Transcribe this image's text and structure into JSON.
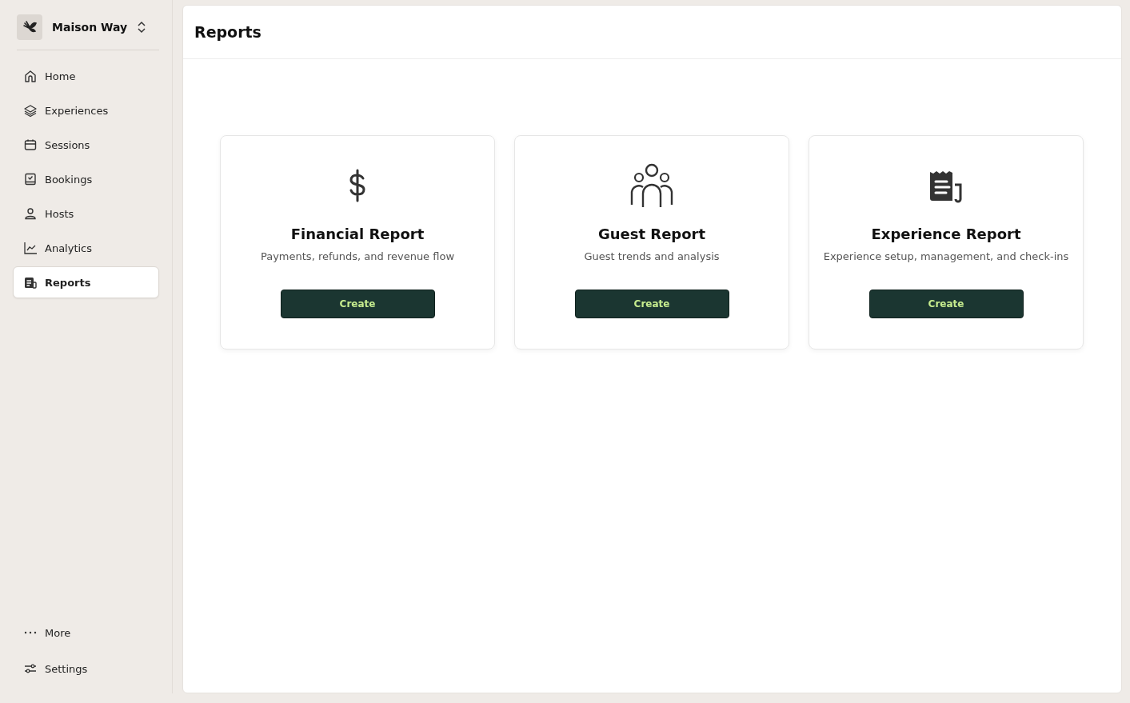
{
  "workspace": {
    "name": "Maison Way"
  },
  "nav": [
    {
      "label": "Home",
      "kind": "home",
      "selected": false
    },
    {
      "label": "Experiences",
      "kind": "layers",
      "selected": false
    },
    {
      "label": "Sessions",
      "kind": "calendar",
      "selected": false
    },
    {
      "label": "Bookings",
      "kind": "booking",
      "selected": false
    },
    {
      "label": "Hosts",
      "kind": "person",
      "selected": false
    },
    {
      "label": "Analytics",
      "kind": "chart",
      "selected": false
    },
    {
      "label": "Reports",
      "kind": "report",
      "selected": true
    }
  ],
  "footer_nav": [
    {
      "label": "More",
      "kind": "more"
    },
    {
      "label": "Settings",
      "kind": "sliders"
    }
  ],
  "page": {
    "title": "Reports"
  },
  "cards": [
    {
      "kind": "dollar",
      "title": "Financial Report",
      "description": "Payments, refunds, and revenue flow",
      "button": "Create"
    },
    {
      "kind": "people",
      "title": "Guest Report",
      "description": "Guest trends and analysis",
      "button": "Create"
    },
    {
      "kind": "receipt",
      "title": "Experience Report",
      "description": "Experience setup, management, and check-ins",
      "button": "Create"
    }
  ]
}
